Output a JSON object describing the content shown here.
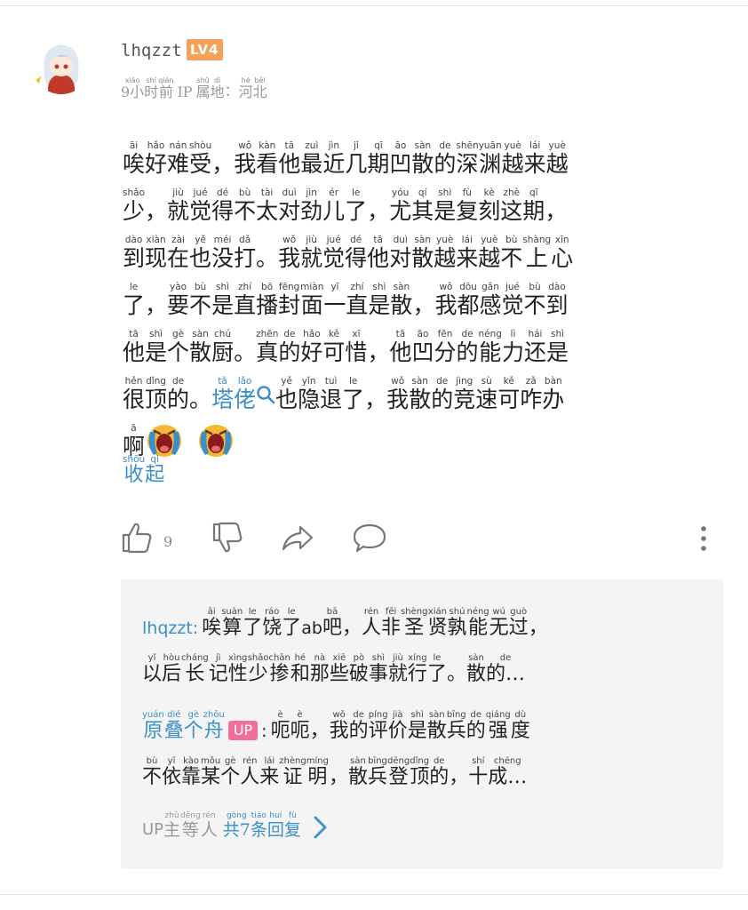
{
  "user": {
    "name": "lhqzzt",
    "level": "LV4"
  },
  "meta": {
    "time": [
      [
        "xiǎo",
        "9小"
      ],
      [
        "shí",
        "时"
      ],
      [
        "qián",
        "前"
      ]
    ],
    "ip_prefix": "IP",
    "ip": [
      [
        "shǔ",
        "属"
      ],
      [
        "dì",
        "地"
      ]
    ],
    "colon": "：",
    "region": [
      [
        "hé",
        "河"
      ],
      [
        "běi",
        "北"
      ]
    ]
  },
  "comment": {
    "lines": [
      [
        [
          "āi",
          "唉"
        ],
        [
          "hǎo",
          "好"
        ],
        [
          "nán",
          "难"
        ],
        [
          "shòu",
          "受"
        ],
        [
          "",
          "，"
        ],
        [
          "wǒ",
          "我"
        ],
        [
          "kàn",
          "看"
        ],
        [
          "tā",
          "他"
        ],
        [
          "zuì",
          "最"
        ],
        [
          "jìn",
          "近"
        ],
        [
          "jǐ",
          "几"
        ],
        [
          "qī",
          "期"
        ],
        [
          "āo",
          "凹"
        ],
        [
          "sàn",
          "散"
        ],
        [
          "de",
          "的"
        ],
        [
          "shēn",
          "深"
        ],
        [
          "yuān",
          "渊"
        ],
        [
          "yuè",
          "越"
        ],
        [
          "lái",
          "来"
        ],
        [
          "yuè",
          "越"
        ]
      ],
      [
        [
          "shǎo",
          "少"
        ],
        [
          "",
          "，"
        ],
        [
          "jiù",
          "就"
        ],
        [
          "jué",
          "觉"
        ],
        [
          "dé",
          "得"
        ],
        [
          "bù",
          "不"
        ],
        [
          "tài",
          "太"
        ],
        [
          "duì",
          "对"
        ],
        [
          "jìn",
          "劲"
        ],
        [
          "ér",
          "儿"
        ],
        [
          "le",
          "了"
        ],
        [
          "",
          "，"
        ],
        [
          "yóu",
          "尤"
        ],
        [
          "qí",
          "其"
        ],
        [
          "shì",
          "是"
        ],
        [
          "fù",
          "复"
        ],
        [
          "kè",
          "刻"
        ],
        [
          "zhè",
          "这"
        ],
        [
          "qī",
          "期"
        ],
        [
          "",
          "，"
        ]
      ],
      [
        [
          "dào",
          "到"
        ],
        [
          "xiàn",
          "现"
        ],
        [
          "zài",
          "在"
        ],
        [
          "yě",
          "也"
        ],
        [
          "méi",
          "没"
        ],
        [
          "dǎ",
          "打"
        ],
        [
          "",
          "。"
        ],
        [
          "wǒ",
          "我"
        ],
        [
          "jiù",
          "就"
        ],
        [
          "jué",
          "觉"
        ],
        [
          "dé",
          "得"
        ],
        [
          "tā",
          "他"
        ],
        [
          "duì",
          "对"
        ],
        [
          "sàn",
          "散"
        ],
        [
          "yuè",
          "越"
        ],
        [
          "lái",
          "来"
        ],
        [
          "yuè",
          "越"
        ],
        [
          "bù",
          "不"
        ],
        [
          "shàng",
          "上"
        ],
        [
          "xīn",
          "心"
        ]
      ],
      [
        [
          "le",
          "了"
        ],
        [
          "",
          "，"
        ],
        [
          "yào",
          "要"
        ],
        [
          "bù",
          "不"
        ],
        [
          "shì",
          "是"
        ],
        [
          "zhí",
          "直"
        ],
        [
          "bō",
          "播"
        ],
        [
          "fēng",
          "封"
        ],
        [
          "miàn",
          "面"
        ],
        [
          "yī",
          "一"
        ],
        [
          "zhí",
          "直"
        ],
        [
          "shì",
          "是"
        ],
        [
          "sàn",
          "散"
        ],
        [
          "",
          "，"
        ],
        [
          "wǒ",
          "我"
        ],
        [
          "dōu",
          "都"
        ],
        [
          "gǎn",
          "感"
        ],
        [
          "jué",
          "觉"
        ],
        [
          "bù",
          "不"
        ],
        [
          "dào",
          "到"
        ]
      ],
      [
        [
          "tā",
          "他"
        ],
        [
          "shì",
          "是"
        ],
        [
          "gè",
          "个"
        ],
        [
          "sàn",
          "散"
        ],
        [
          "chú",
          "厨"
        ],
        [
          "",
          "。"
        ],
        [
          "zhēn",
          "真"
        ],
        [
          "de",
          "的"
        ],
        [
          "hǎo",
          "好"
        ],
        [
          "kě",
          "可"
        ],
        [
          "xī",
          "惜"
        ],
        [
          "",
          "，"
        ],
        [
          "tā",
          "他"
        ],
        [
          "āo",
          "凹"
        ],
        [
          "fēn",
          "分"
        ],
        [
          "de",
          "的"
        ],
        [
          "néng",
          "能"
        ],
        [
          "lì",
          "力"
        ],
        [
          "hái",
          "还"
        ],
        [
          "shì",
          "是"
        ]
      ],
      [
        [
          "hěn",
          "很"
        ],
        [
          "dǐng",
          "顶"
        ],
        [
          "de",
          "的"
        ],
        [
          "",
          "。"
        ],
        [
          "tǎ",
          "塔",
          "link"
        ],
        [
          "lǎo",
          "佬",
          "link"
        ],
        [
          "search",
          "search"
        ],
        [
          "yě",
          "也"
        ],
        [
          "yǐn",
          "隐"
        ],
        [
          "tuì",
          "退"
        ],
        [
          "le",
          "了"
        ],
        [
          "",
          "，"
        ],
        [
          "wǒ",
          "我"
        ],
        [
          "sàn",
          "散"
        ],
        [
          "de",
          "的"
        ],
        [
          "jìng",
          "竞"
        ],
        [
          "sù",
          "速"
        ],
        [
          "kě",
          "可"
        ],
        [
          "zǎ",
          "咋"
        ],
        [
          "bàn",
          "办"
        ]
      ],
      [
        [
          "ā",
          "啊"
        ],
        [
          "emoji",
          "crying-emoji"
        ],
        [
          "emoji",
          "crying-emoji"
        ]
      ]
    ],
    "collapse": [
      [
        "shōu",
        "收"
      ],
      [
        "qǐ",
        "起"
      ]
    ]
  },
  "actions": {
    "like_count": "9"
  },
  "replies": [
    {
      "name": "lhqzzt",
      "sep": ":",
      "lines": [
        [
          [
            "āi",
            "唉"
          ],
          [
            "suàn",
            "算"
          ],
          [
            "le",
            "了"
          ],
          [
            "ráo",
            "饶"
          ],
          [
            "le",
            "了"
          ],
          [
            "",
            "ab"
          ],
          [
            "bā",
            "吧"
          ],
          [
            "",
            "，"
          ],
          [
            "rén",
            "人"
          ],
          [
            "fēi",
            "非"
          ],
          [
            "shèng",
            "圣"
          ],
          [
            "xián",
            "贤"
          ],
          [
            "shú",
            "孰"
          ],
          [
            "néng",
            "能"
          ],
          [
            "wú",
            "无"
          ],
          [
            "guò",
            "过"
          ],
          [
            "",
            "，"
          ]
        ],
        [
          [
            "yǐ",
            "以"
          ],
          [
            "hòu",
            "后"
          ],
          [
            "cháng",
            "长"
          ],
          [
            "jì",
            "记"
          ],
          [
            "xìng",
            "性"
          ],
          [
            "shǎo",
            "少"
          ],
          [
            "chān",
            "掺"
          ],
          [
            "hé",
            "和"
          ],
          [
            "nà",
            "那"
          ],
          [
            "xiē",
            "些"
          ],
          [
            "pò",
            "破"
          ],
          [
            "shì",
            "事"
          ],
          [
            "jiù",
            "就"
          ],
          [
            "xíng",
            "行"
          ],
          [
            "le",
            "了"
          ],
          [
            "",
            "。"
          ],
          [
            "sàn",
            "散"
          ],
          [
            "de",
            "的…"
          ]
        ]
      ]
    },
    {
      "name_ruby": [
        [
          "yuán",
          "原"
        ],
        [
          "dié",
          "叠"
        ],
        [
          "gè",
          "个"
        ],
        [
          "zhōu",
          "舟"
        ]
      ],
      "badge": "UP",
      "sep": ":",
      "lines": [
        [
          [
            "è",
            "呃"
          ],
          [
            "è",
            "呃"
          ],
          [
            "",
            "，"
          ],
          [
            "wǒ",
            "我"
          ],
          [
            "de",
            "的"
          ],
          [
            "píng",
            "评"
          ],
          [
            "jià",
            "价"
          ],
          [
            "shì",
            "是"
          ],
          [
            "sàn",
            "散"
          ],
          [
            "bīng",
            "兵"
          ],
          [
            "de",
            "的"
          ],
          [
            "qiáng",
            "强"
          ],
          [
            "dù",
            "度"
          ]
        ],
        [
          [
            "bù",
            "不"
          ],
          [
            "yī",
            "依"
          ],
          [
            "kào",
            "靠"
          ],
          [
            "mǒu",
            "某"
          ],
          [
            "gè",
            "个"
          ],
          [
            "rén",
            "人"
          ],
          [
            "lái",
            "来"
          ],
          [
            "zhèng",
            "证"
          ],
          [
            "míng",
            "明"
          ],
          [
            "",
            "，"
          ],
          [
            "sàn",
            "散"
          ],
          [
            "bīng",
            "兵"
          ],
          [
            "dēng",
            "登"
          ],
          [
            "dǐng",
            "顶"
          ],
          [
            "de",
            "的"
          ],
          [
            "",
            "，"
          ],
          [
            "shí",
            "十"
          ],
          [
            "chéng",
            "成…"
          ]
        ]
      ]
    }
  ],
  "footer": {
    "prefix": "UP",
    "ruby": [
      [
        "zhǔ",
        "主"
      ],
      [
        "děng",
        "等"
      ],
      [
        "rén",
        "人"
      ]
    ],
    "total": [
      [
        "gòng",
        "共7"
      ],
      [
        "tiáo",
        "条"
      ],
      [
        "huí",
        "回"
      ],
      [
        "fù",
        "复"
      ]
    ]
  },
  "colors": {
    "link": "#3a8fc8",
    "level": "#f2a25a",
    "up_badge": "#f0709a",
    "reply_bg": "#f4f4f4"
  }
}
